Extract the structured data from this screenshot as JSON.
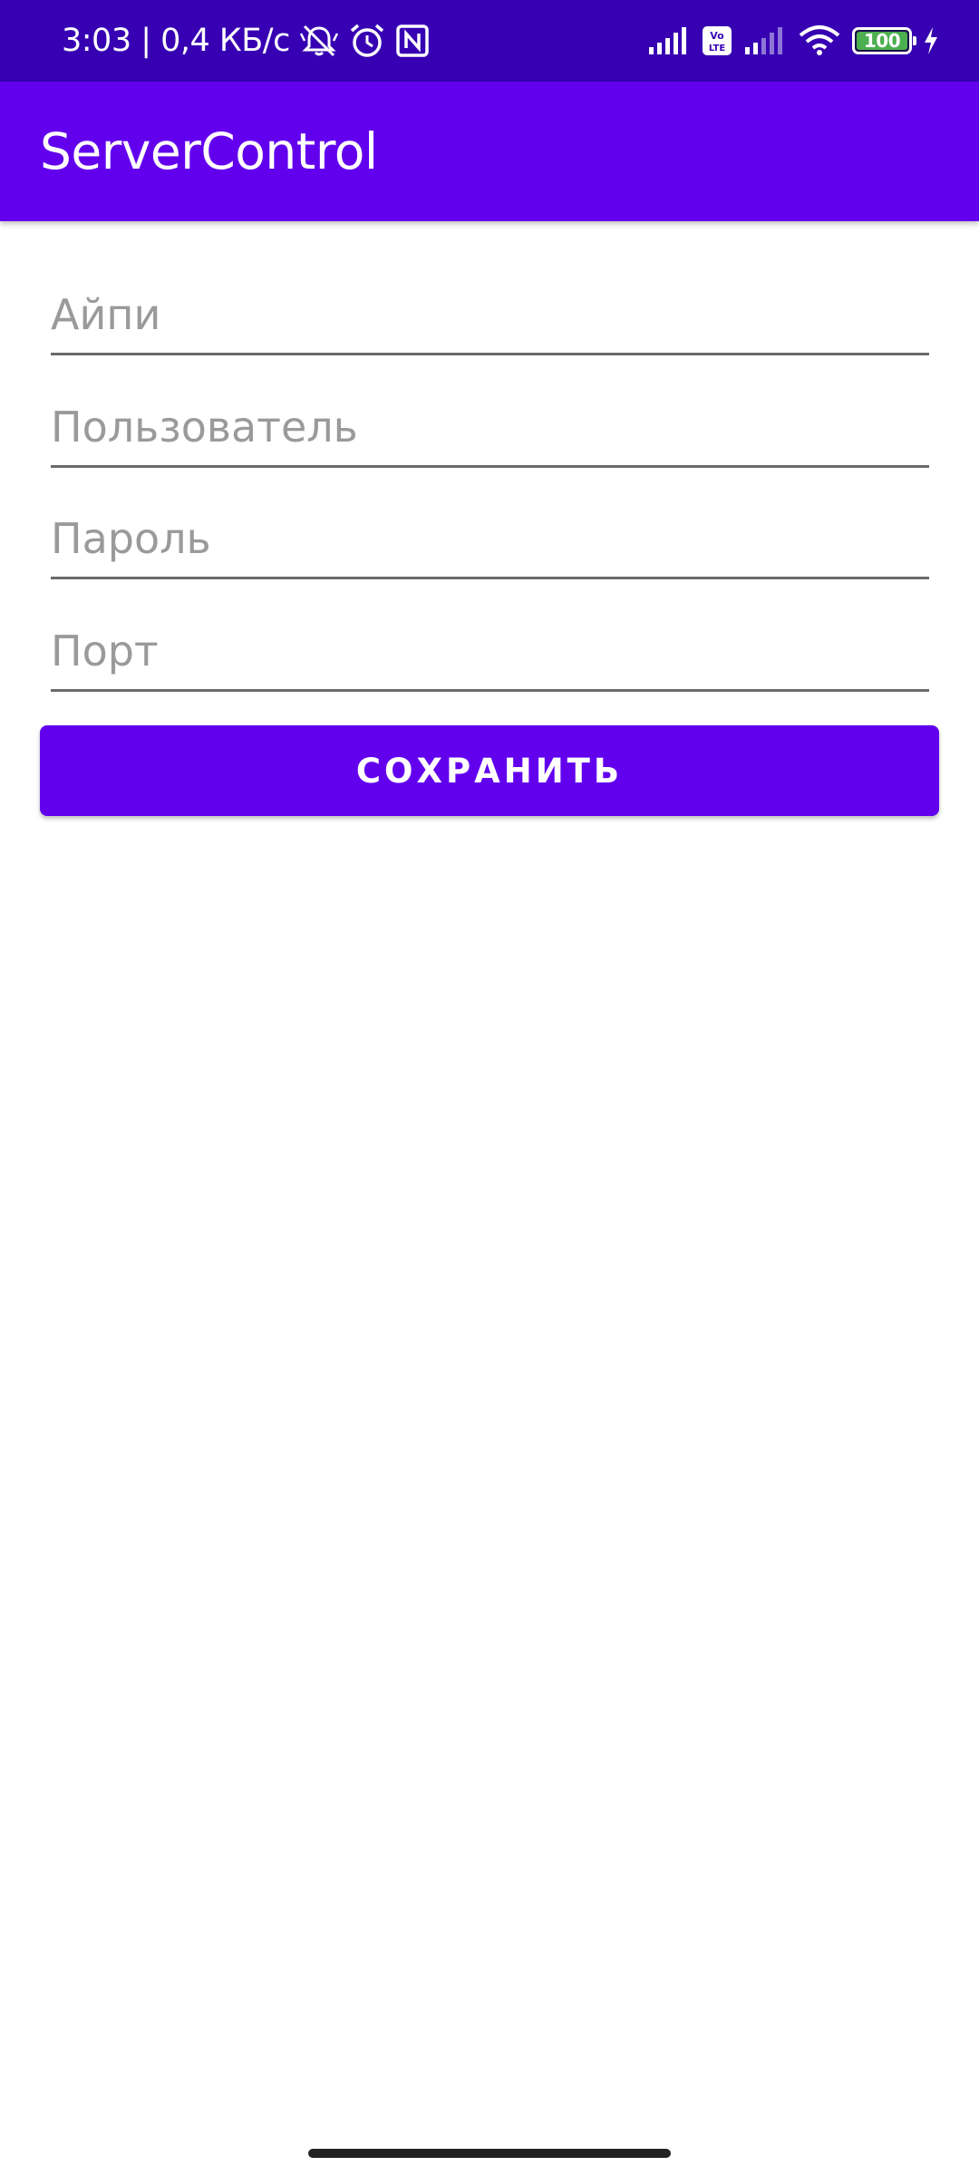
{
  "status_bar": {
    "time_speed": "3:03 | 0,4 КБ/с",
    "battery_level": "100",
    "icons": [
      "bell-muted-icon",
      "alarm-icon",
      "nfc-icon",
      "signal-icon",
      "volte-icon",
      "signal-icon-2",
      "wifi-icon",
      "battery-icon",
      "charging-icon"
    ],
    "colors": {
      "background": "#3700B3",
      "battery_fill": "#4CAF50"
    }
  },
  "app_bar": {
    "title": "ServerControl",
    "color": "#6200EE"
  },
  "form": {
    "ip_placeholder": "Айпи",
    "user_placeholder": "Пользователь",
    "password_placeholder": "Пароль",
    "port_placeholder": "Порт",
    "ip_value": "",
    "user_value": "",
    "password_value": "",
    "port_value": ""
  },
  "actions": {
    "save_label": "СОХРАНИТЬ"
  }
}
